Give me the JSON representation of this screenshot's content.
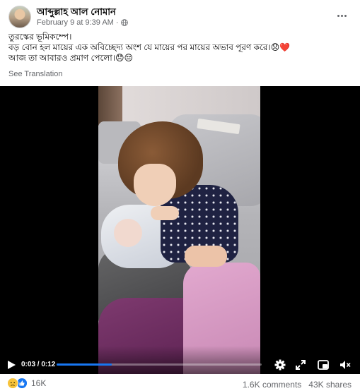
{
  "post": {
    "author_name": "আব্দুল্লাহ আল নোমান",
    "timestamp": "February 9 at 9:39 AM",
    "privacy_icon": "globe-icon",
    "more_icon": "more-options-icon",
    "caption_lines": [
      "তুরস্কের ভূমিকম্পে।",
      "বড় বোন হল মায়ের এক অবিচ্ছেদ্য অংশ যে মায়ের পর মায়ের অভাব পূরণ করে।😞❤️",
      "আজ তা আবারও প্রমাণ পেলো।😞😔"
    ],
    "see_translation": "See Translation"
  },
  "video": {
    "current_time": "0:03",
    "duration": "0:12",
    "time_display": "0:03 / 0:12",
    "progress": 0.27,
    "controls": [
      "play-icon",
      "settings-icon",
      "fullscreen-icon",
      "picture-in-picture-icon",
      "volume-icon"
    ],
    "accent_color": "#1877f2"
  },
  "footer": {
    "reaction_icons": [
      "sad-reaction-icon",
      "like-reaction-icon"
    ],
    "reaction_count": "16K",
    "comments": "1.6K comments",
    "shares": "43K shares"
  }
}
